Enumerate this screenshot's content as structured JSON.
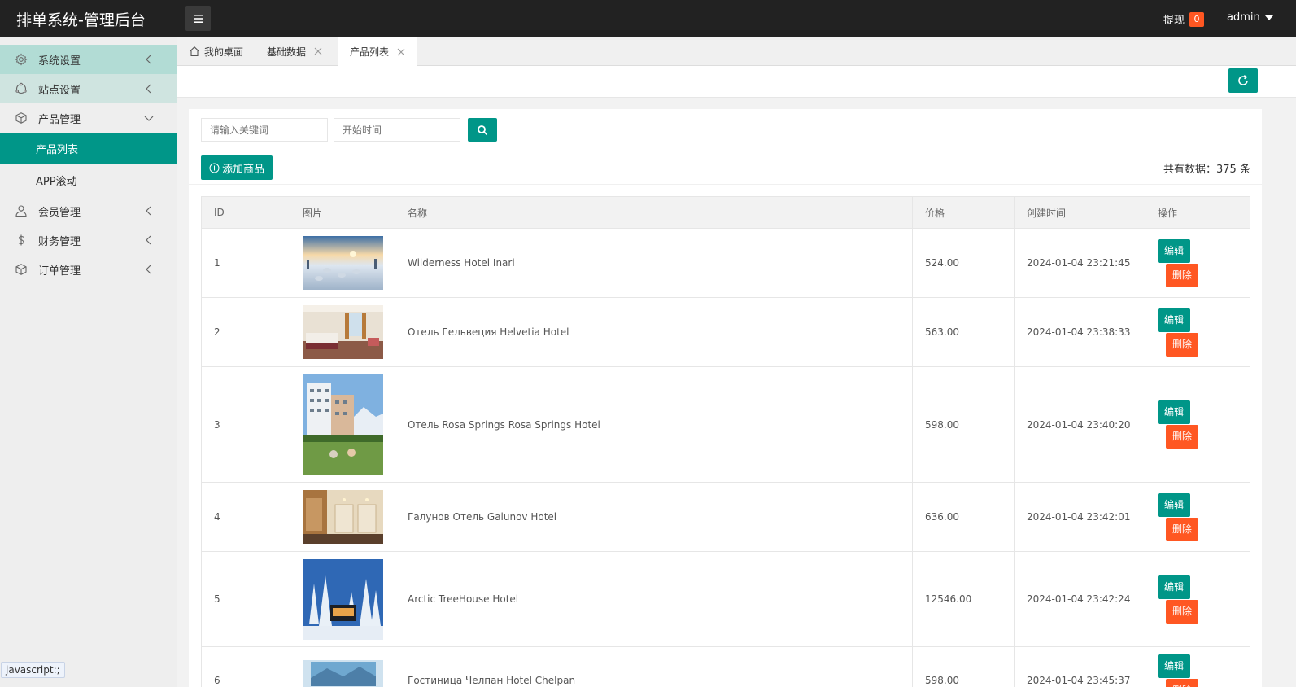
{
  "header": {
    "title": "排单系统-管理后台",
    "withdraw_label": "提现",
    "withdraw_count": "0",
    "user": "admin"
  },
  "sidebar": {
    "items": [
      {
        "label": "系统设置",
        "icon": "gear-icon"
      },
      {
        "label": "站点设置",
        "icon": "site-icon"
      },
      {
        "label": "产品管理",
        "icon": "box-icon"
      },
      {
        "label": "产品列表"
      },
      {
        "label": "APP滚动"
      },
      {
        "label": "会员管理",
        "icon": "user-icon"
      },
      {
        "label": "财务管理",
        "icon": "dollar-icon"
      },
      {
        "label": "订单管理",
        "icon": "box-icon"
      }
    ],
    "status_tip": "javascript:;"
  },
  "tabs": [
    {
      "label": "我的桌面"
    },
    {
      "label": "基础数据"
    },
    {
      "label": "产品列表"
    }
  ],
  "search": {
    "keyword_placeholder": "请输入关键词",
    "start_time_placeholder": "开始时间"
  },
  "add_button": "添加商品",
  "total": {
    "label": "共有数据：",
    "count": "375",
    "unit": "条"
  },
  "table": {
    "columns": [
      "ID",
      "图片",
      "名称",
      "价格",
      "创建时间",
      "操作"
    ],
    "edit_label": "编辑",
    "delete_label": "删除",
    "rows": [
      {
        "id": "1",
        "name": "Wilderness Hotel Inari",
        "price": "524.00",
        "created": "2024-01-04 23:21:45",
        "image": "snowy-resort"
      },
      {
        "id": "2",
        "name": "Отель Гельвеция Helvetia Hotel",
        "price": "563.00",
        "created": "2024-01-04 23:38:33",
        "image": "hotel-room"
      },
      {
        "id": "3",
        "name": "Отель Rosa Springs Rosa Springs Hotel",
        "price": "598.00",
        "created": "2024-01-04 23:40:20",
        "image": "hotel-building"
      },
      {
        "id": "4",
        "name": "Галунов Отель Galunov Hotel",
        "price": "636.00",
        "created": "2024-01-04 23:42:01",
        "image": "hotel-corridor"
      },
      {
        "id": "5",
        "name": "Arctic TreeHouse Hotel",
        "price": "12546.00",
        "created": "2024-01-04 23:42:24",
        "image": "winter-forest"
      },
      {
        "id": "6",
        "name": "Гостиница Челпан Hotel Chelpan",
        "price": "598.00",
        "created": "2024-01-04 23:45:37",
        "image": "lake-view"
      }
    ]
  },
  "colors": {
    "primary": "#009688",
    "danger": "#ff5722",
    "header_bg": "#222222"
  }
}
